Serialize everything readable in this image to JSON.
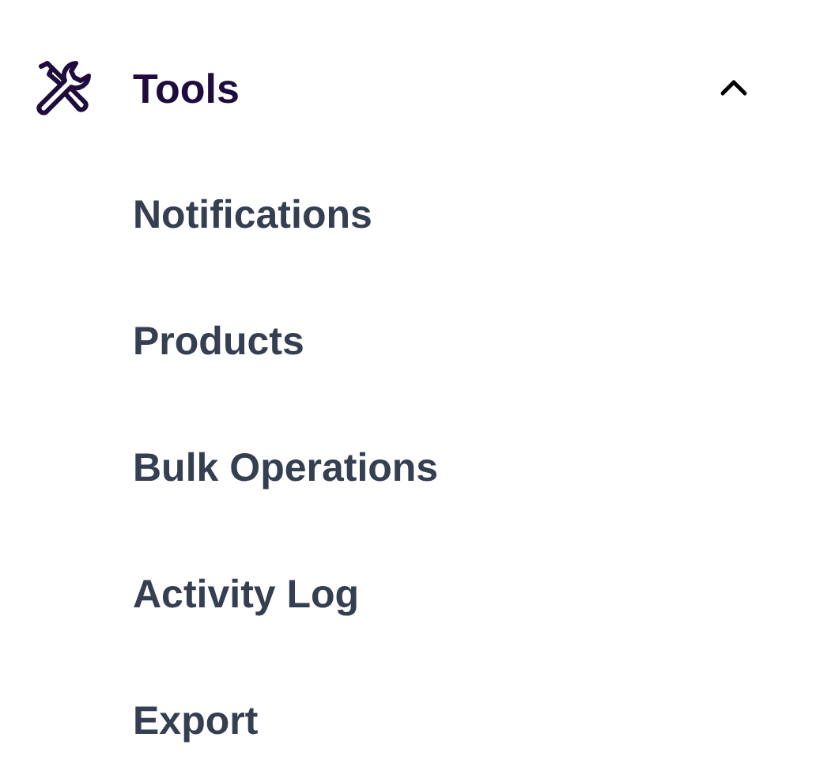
{
  "section": {
    "title": "Tools",
    "expanded": true,
    "items": [
      {
        "label": "Notifications"
      },
      {
        "label": "Products"
      },
      {
        "label": "Bulk Operations"
      },
      {
        "label": "Activity Log"
      },
      {
        "label": "Export"
      }
    ]
  }
}
